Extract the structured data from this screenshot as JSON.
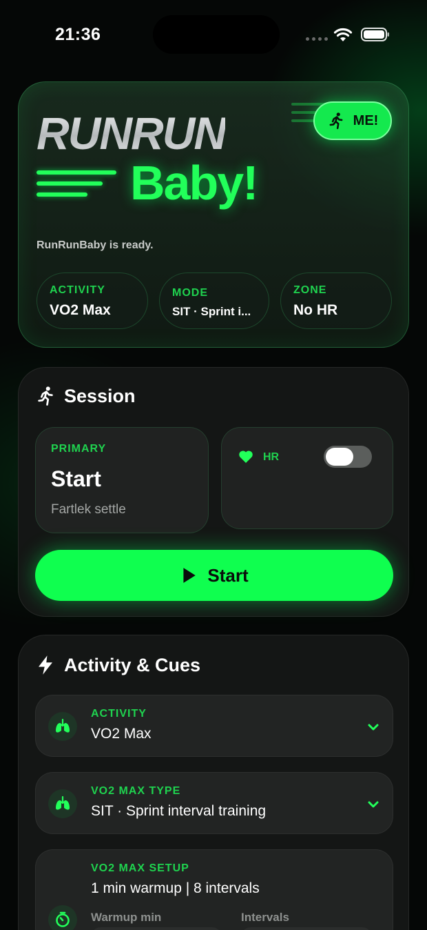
{
  "status_bar": {
    "time": "21:36"
  },
  "hero": {
    "brand_title": "RUNRUN",
    "brand_sub": "Baby!",
    "me_label": "ME!",
    "ready_text": "RunRunBaby is ready.",
    "chips": [
      {
        "label": "ACTIVITY",
        "value": "VO2 Max"
      },
      {
        "label": "MODE",
        "value": "SIT · Sprint i..."
      },
      {
        "label": "ZONE",
        "value": "No HR"
      }
    ]
  },
  "session": {
    "title": "Session",
    "primary_tile": {
      "label": "PRIMARY",
      "value": "Start",
      "sub": "Fartlek settle"
    },
    "hr_tile": {
      "label": "HR",
      "toggle_on": false
    },
    "start_button": "Start"
  },
  "activity_cues": {
    "title": "Activity & Cues",
    "rows": [
      {
        "label": "ACTIVITY",
        "value": "VO2 Max"
      },
      {
        "label": "VO2 MAX TYPE",
        "value": "SIT · Sprint interval training"
      }
    ],
    "setup": {
      "label": "VO2 MAX SETUP",
      "value": "1 min warmup | 8 intervals",
      "fields": [
        "Warmup min",
        "Intervals"
      ]
    }
  },
  "colors": {
    "accent": "#22ff5a",
    "card": "#141615",
    "background": "#050706"
  }
}
